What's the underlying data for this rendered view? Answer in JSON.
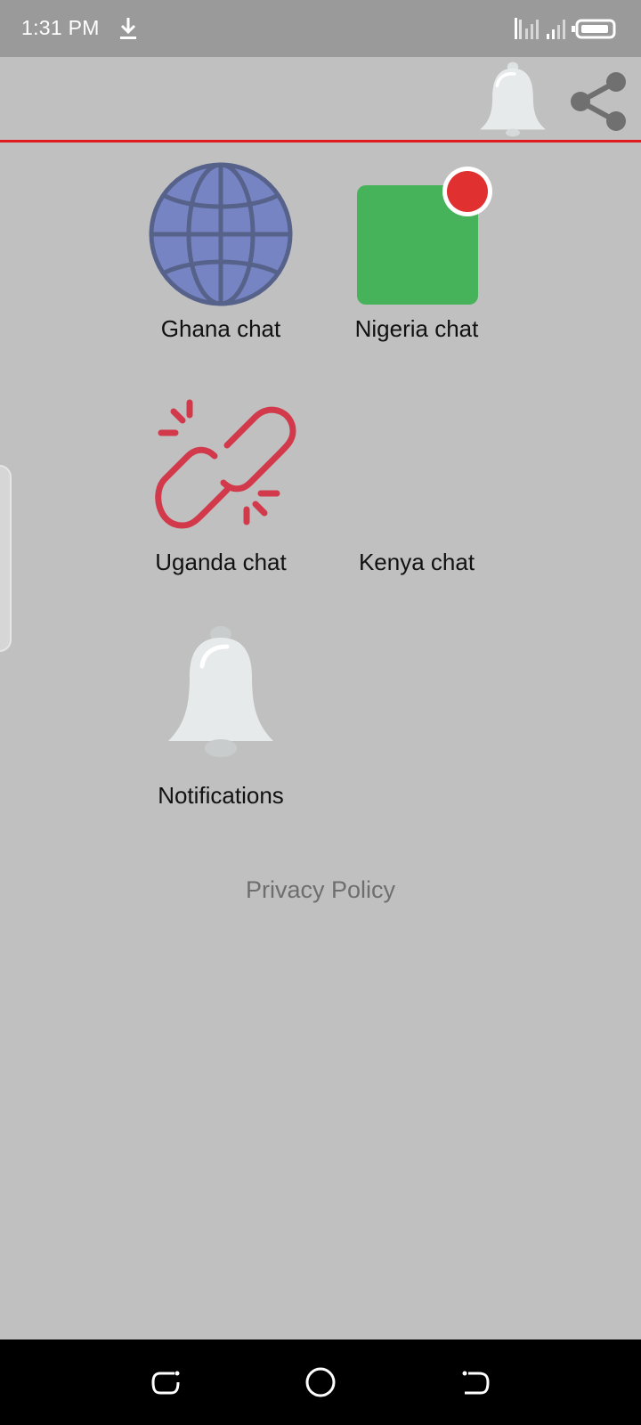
{
  "status_bar": {
    "time": "1:31 PM",
    "icons": [
      "download-icon",
      "signal-icon",
      "battery-icon"
    ]
  },
  "app_bar": {
    "icons": [
      "bell-icon",
      "share-icon"
    ],
    "accent_color": "#e01a1f"
  },
  "tiles": [
    {
      "label": "Ghana chat",
      "icon": "globe-icon"
    },
    {
      "label": "Nigeria chat",
      "icon": "chat-square-icon",
      "badge": "red-dot"
    },
    {
      "label": "Uganda chat",
      "icon": "broken-link-icon"
    },
    {
      "label": "Kenya chat",
      "icon": "none"
    },
    {
      "label": "Notifications",
      "icon": "bell-icon"
    }
  ],
  "privacy_policy": "Privacy Policy",
  "nav_bar": [
    "recents-icon",
    "home-icon",
    "back-icon"
  ],
  "colors": {
    "background": "#c0c0c0",
    "globe": "#7684c4",
    "nigeria_square": "#46b35a",
    "badge": "#e03030",
    "broken_link": "#d23a4c"
  }
}
